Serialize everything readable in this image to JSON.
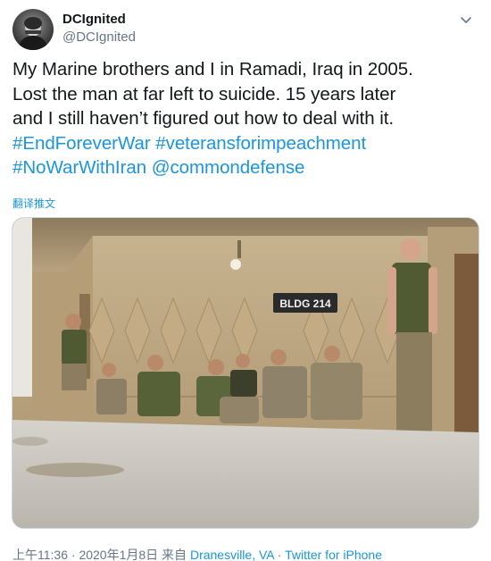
{
  "author": {
    "display_name": "DCIgnited",
    "handle": "@DCIgnited"
  },
  "tweet": {
    "line1": "My Marine brothers and I in Ramadi, Iraq in 2005.",
    "line2": "Lost the man at far left to suicide. 15 years later",
    "line3": "and I still haven’t figured out how to deal with it.",
    "hashtag_endforeverwar": "#EndForeverWar",
    "hashtag_veterans": "#veteransforimpeachment",
    "hashtag_nowarwithiran": "#NoWarWithIran",
    "mention_commondefense": "@commondefense",
    "translate_label": "翻译推文"
  },
  "photo": {
    "sign_text": "BLDG 214"
  },
  "meta": {
    "time": "上午11:36",
    "separator1": " · ",
    "date": "2020年1月8日",
    "from_label": " 来自 ",
    "location": "Dranesville, VA",
    "separator2": " · ",
    "source": "Twitter for iPhone"
  },
  "colors": {
    "link": "#1b95e0",
    "text": "#14171a",
    "secondary": "#657786"
  },
  "icons": {
    "caret": "chevron-down-icon",
    "avatar": "avatar"
  }
}
